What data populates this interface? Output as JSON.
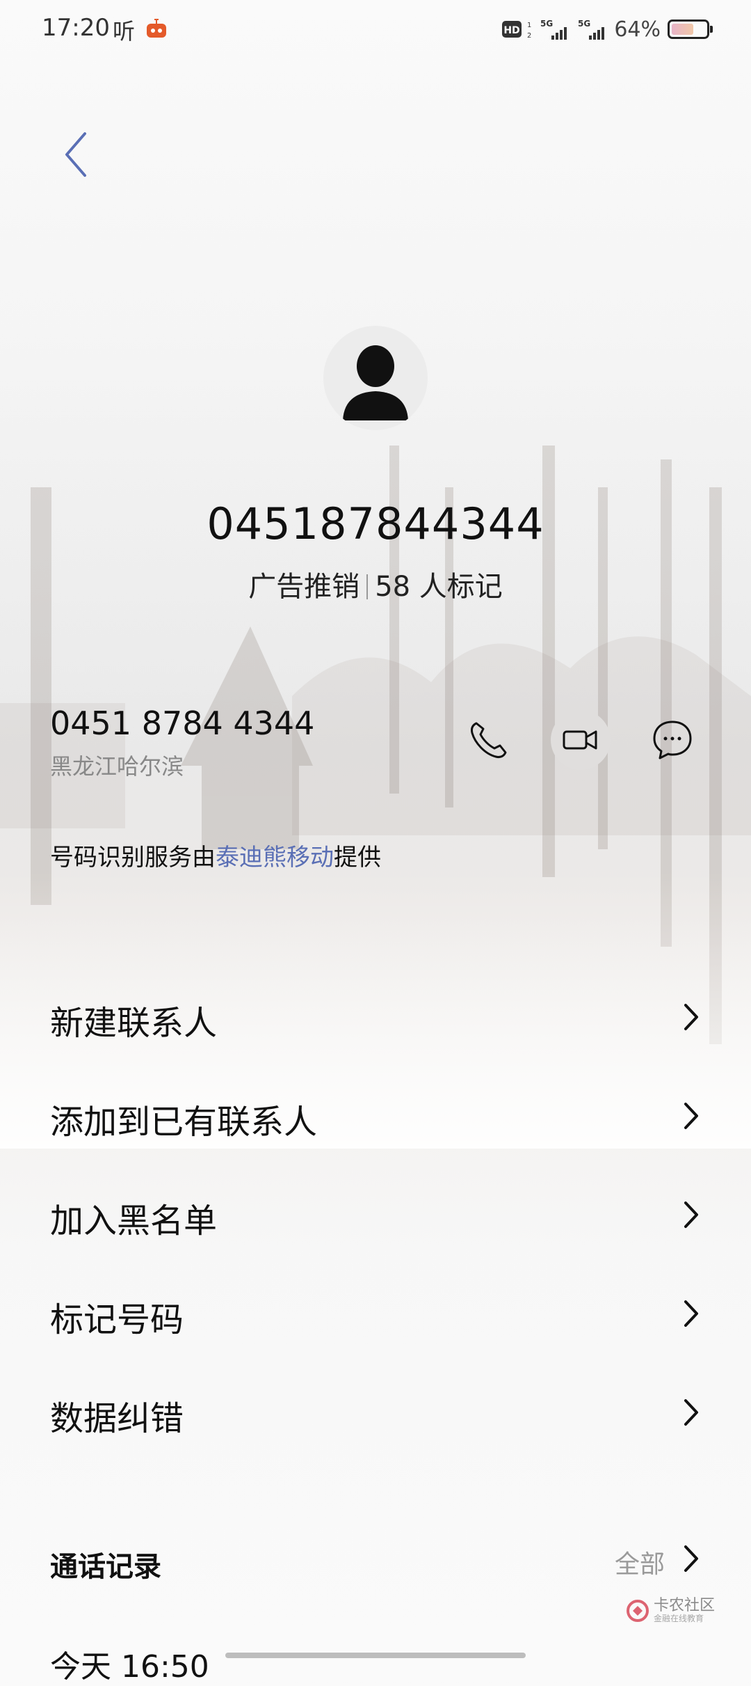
{
  "status_bar": {
    "time": "17:20",
    "ting": "听",
    "hd_label": "HD",
    "network_1": "5G",
    "network_2": "5G",
    "battery_percent": "64%",
    "battery_level": 0.64
  },
  "header": {
    "back_icon": "chevron-left-icon"
  },
  "caller": {
    "number_title": "045187844344",
    "tag": "广告推销",
    "mark_count": "58 人标记",
    "number_formatted": "0451 8784 4344",
    "location": "黑龙江哈尔滨"
  },
  "actions": {
    "call_icon": "phone-icon",
    "video_icon": "video-call-icon",
    "message_icon": "message-icon"
  },
  "provider": {
    "prefix": "号码识别服务由",
    "name": "泰迪熊移动",
    "suffix": "提供"
  },
  "menu": [
    {
      "label": "新建联系人"
    },
    {
      "label": "添加到已有联系人"
    },
    {
      "label": "加入黑名单"
    },
    {
      "label": "标记号码"
    },
    {
      "label": "数据纠错"
    }
  ],
  "call_log": {
    "title": "通话记录",
    "all_label": "全部",
    "first_row_partial": "今天 16:50"
  },
  "watermark": {
    "name": "卡农社区",
    "sub": "金融在线教育"
  },
  "colors": {
    "accent": "#5a6fb5",
    "secondary_text": "#888888"
  }
}
